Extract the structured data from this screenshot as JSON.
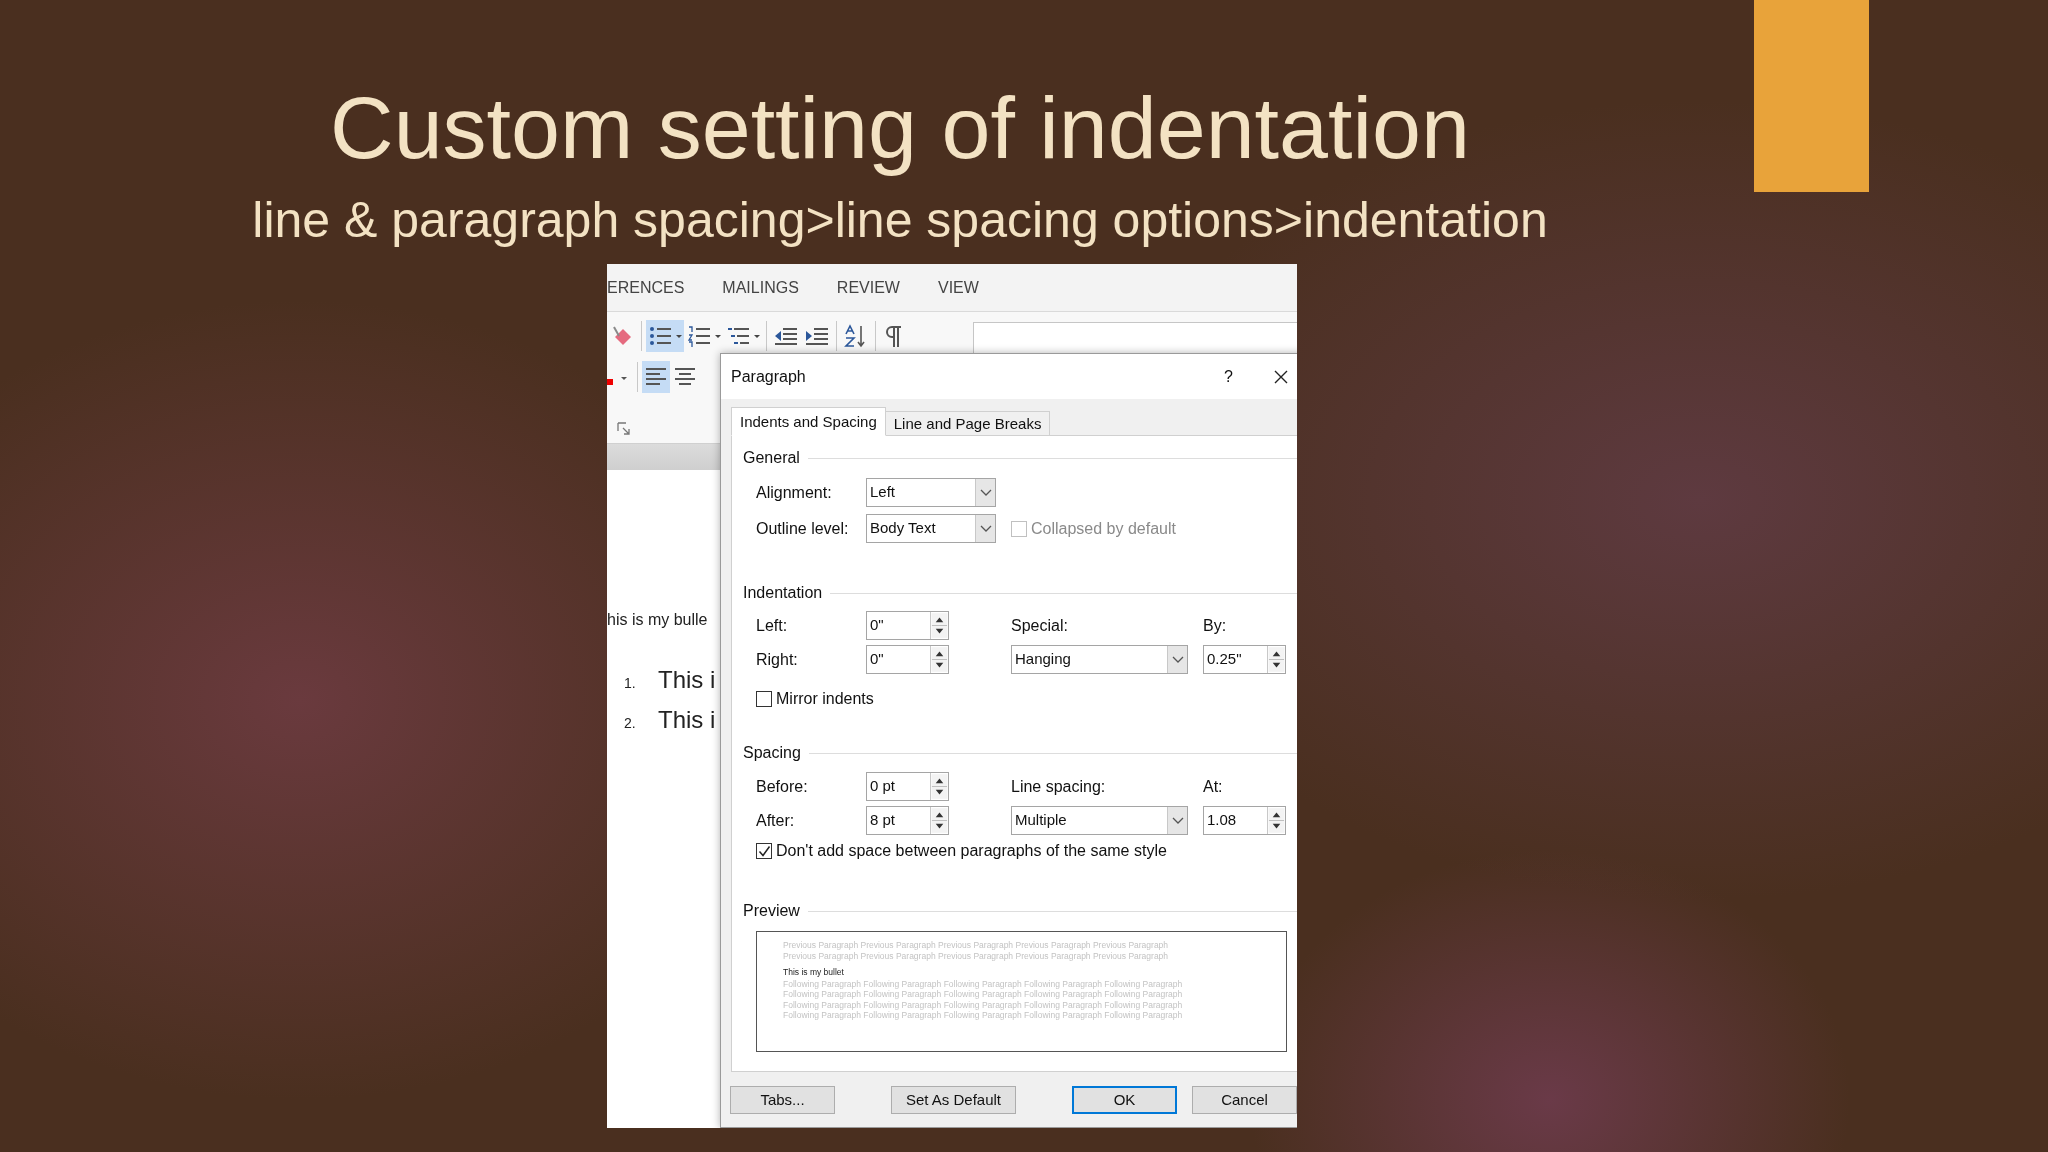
{
  "slide": {
    "title": "Custom setting of indentation",
    "subtitle": "line & paragraph spacing>line spacing options>indentation"
  },
  "word_window": {
    "ribbon_tabs": [
      "ERENCES",
      "MAILINGS",
      "REVIEW",
      "VIEW"
    ],
    "ribbon_tools_top": [
      {
        "kind": "bullets",
        "selected": true
      },
      {
        "kind": "numbering",
        "selected": false
      },
      {
        "kind": "multilevel",
        "selected": false
      },
      {
        "kind": "outdent",
        "selected": false
      },
      {
        "kind": "indent",
        "selected": false
      },
      {
        "kind": "sort",
        "selected": false
      },
      {
        "kind": "pilcrow",
        "selected": false
      }
    ],
    "ribbon_tools_bottom": [
      {
        "kind": "align_left",
        "selected": true
      },
      {
        "kind": "align_center",
        "selected": false
      }
    ],
    "document_lines": [
      {
        "kind": "text",
        "text": "his is my bulle"
      },
      {
        "kind": "numbered",
        "number": "1.",
        "text": "This i"
      },
      {
        "kind": "numbered",
        "number": "2.",
        "text": "This i"
      }
    ]
  },
  "dialog": {
    "title": "Paragraph",
    "help": "?",
    "tabs": [
      {
        "label": "Indents and Spacing",
        "selected": true
      },
      {
        "label": "Line and Page Breaks",
        "selected": false
      }
    ],
    "general": {
      "heading": "General",
      "alignment": {
        "label": "Alignment:",
        "value": "Left"
      },
      "outline_level": {
        "label": "Outline level:",
        "value": "Body Text"
      },
      "collapsed": {
        "label": "Collapsed by default",
        "checked": false,
        "disabled": true
      }
    },
    "indentation": {
      "heading": "Indentation",
      "left": {
        "label": "Left:",
        "value": "0\""
      },
      "right": {
        "label": "Right:",
        "value": "0\""
      },
      "special": {
        "label": "Special:",
        "value": "Hanging"
      },
      "by": {
        "label": "By:",
        "value": "0.25\""
      },
      "mirror": {
        "label": "Mirror indents",
        "checked": false,
        "disabled": false
      }
    },
    "spacing": {
      "heading": "Spacing",
      "before": {
        "label": "Before:",
        "value": "0 pt"
      },
      "after": {
        "label": "After:",
        "value": "8 pt"
      },
      "line_spacing": {
        "label": "Line spacing:",
        "value": "Multiple"
      },
      "at": {
        "label": "At:",
        "value": "1.08"
      },
      "dont_add": {
        "label": "Don't add space between paragraphs of the same style",
        "checked": true,
        "disabled": false
      }
    },
    "preview": {
      "heading": "Preview",
      "previous_lines": [
        "Previous Paragraph Previous Paragraph Previous Paragraph Previous Paragraph Previous Paragraph",
        "Previous Paragraph Previous Paragraph Previous Paragraph Previous Paragraph Previous Paragraph"
      ],
      "current": "This is my bullet",
      "following_lines": [
        "Following Paragraph Following Paragraph Following Paragraph Following Paragraph Following Paragraph",
        "Following Paragraph Following Paragraph Following Paragraph Following Paragraph Following Paragraph",
        "Following Paragraph Following Paragraph Following Paragraph Following Paragraph Following Paragraph",
        "Following Paragraph Following Paragraph Following Paragraph Following Paragraph Following Paragraph"
      ]
    },
    "buttons": [
      {
        "label": "Tabs...",
        "default": false
      },
      {
        "label": "Set As Default",
        "default": false
      },
      {
        "label": "OK",
        "default": true
      },
      {
        "label": "Cancel",
        "default": false
      }
    ]
  }
}
